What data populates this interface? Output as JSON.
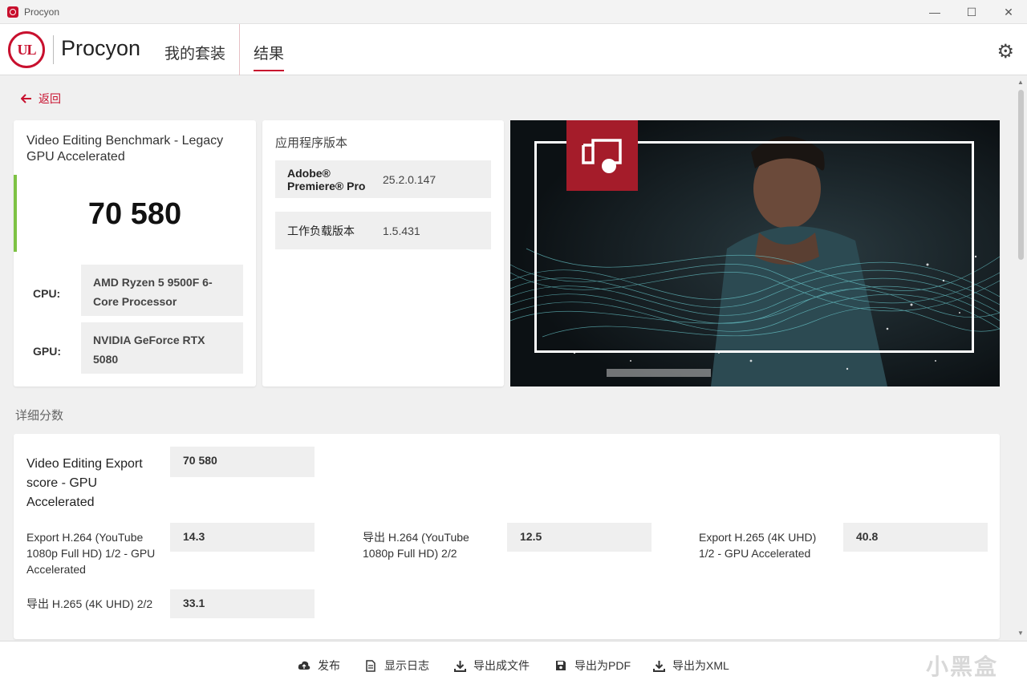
{
  "window": {
    "title": "Procyon",
    "controls": [
      "minimize",
      "maximize",
      "close"
    ]
  },
  "header": {
    "logo_text": "UL",
    "brand": "Procyon",
    "tabs": [
      {
        "label": "我的套装",
        "active": false
      },
      {
        "label": "结果",
        "active": true
      }
    ],
    "settings_icon": "gear-icon"
  },
  "back": {
    "label": "返回"
  },
  "summary": {
    "benchmark_title": "Video Editing Benchmark - Legacy GPU Accelerated",
    "score": "70 580",
    "cpu_label": "CPU:",
    "cpu_value": "AMD Ryzen 5 9500F 6-Core Processor",
    "gpu_label": "GPU:",
    "gpu_value": "NVIDIA GeForce RTX 5080"
  },
  "versions": {
    "title": "应用程序版本",
    "rows": [
      {
        "name": "Adobe® Premiere® Pro",
        "value": "25.2.0.147"
      },
      {
        "name": "工作负载版本",
        "value": "1.5.431"
      }
    ]
  },
  "details": {
    "section_title": "详细分数",
    "main": {
      "label": "Video Editing Export score - GPU Accelerated",
      "value": "70 580"
    },
    "items": [
      {
        "label": "Export H.264 (YouTube 1080p Full HD) 1/2 - GPU Accelerated",
        "value": "14.3"
      },
      {
        "label": "导出 H.264 (YouTube 1080p Full HD) 2/2",
        "value": "12.5"
      },
      {
        "label": "Export H.265 (4K UHD) 1/2 - GPU Accelerated",
        "value": "40.8"
      },
      {
        "label": "导出 H.265 (4K UHD) 2/2",
        "value": "33.1"
      }
    ]
  },
  "bottom_actions": [
    {
      "label": "发布",
      "icon": "cloud-upload-icon"
    },
    {
      "label": "显示日志",
      "icon": "document-icon"
    },
    {
      "label": "导出成文件",
      "icon": "download-icon"
    },
    {
      "label": "导出为PDF",
      "icon": "save-icon"
    },
    {
      "label": "导出为XML",
      "icon": "download-icon"
    }
  ],
  "watermark": "小黑盒",
  "colors": {
    "accent": "#c8102e",
    "score_bar": "#7dc243",
    "badge": "#a51c2a"
  }
}
